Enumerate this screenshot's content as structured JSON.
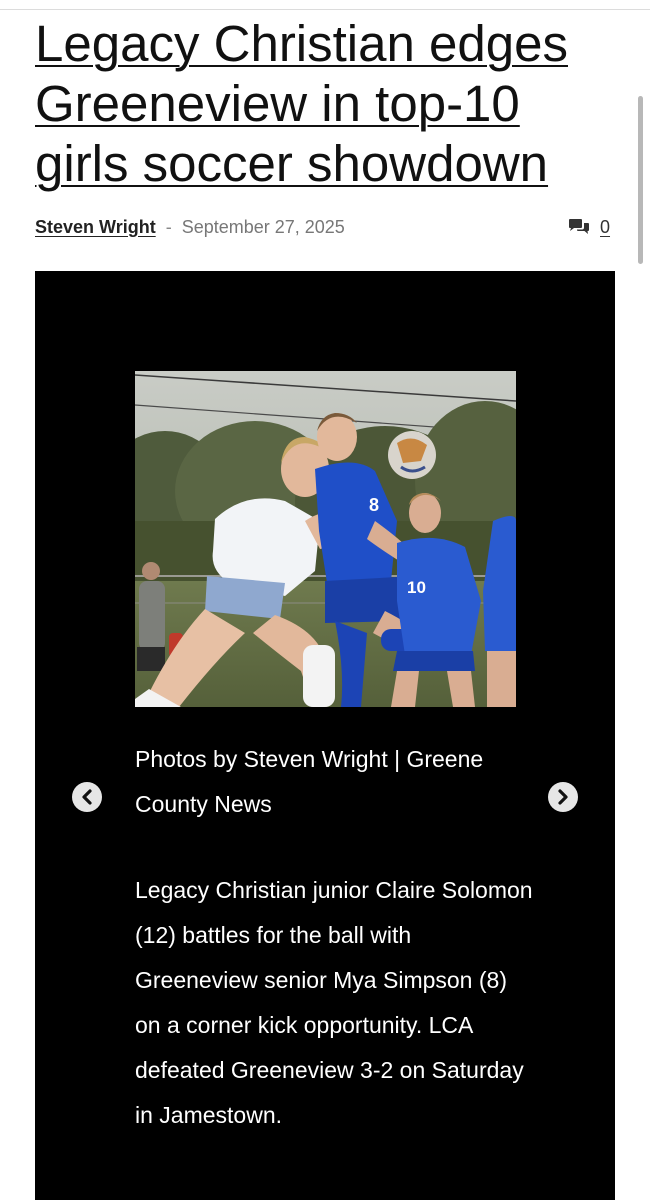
{
  "article": {
    "headline": "Legacy Christian edges Greeneview in top-10 girls soccer showdown",
    "author": "Steven Wright",
    "separator": "-",
    "date": "September 27, 2025",
    "comment_count": "0"
  },
  "gallery": {
    "photo_credit": "Photos by Steven Wright | Greene County News",
    "caption": "Legacy Christian junior Claire Solomon (12) battles for the ball with Greeneview senior Mya Simpson (8) on a corner kick opportunity. LCA defeated Greeneview 3-2 on Saturday in Jamestown.",
    "prev_icon": "chevron-left-icon",
    "next_icon": "chevron-right-icon",
    "photo_jersey_numbers": [
      "8",
      "10"
    ]
  },
  "colors": {
    "gallery_background": "#000000",
    "headline": "#111111",
    "meta_gray": "#777777",
    "jersey_blue": "#1f4fc8",
    "jersey_white": "#f2f4f7"
  }
}
